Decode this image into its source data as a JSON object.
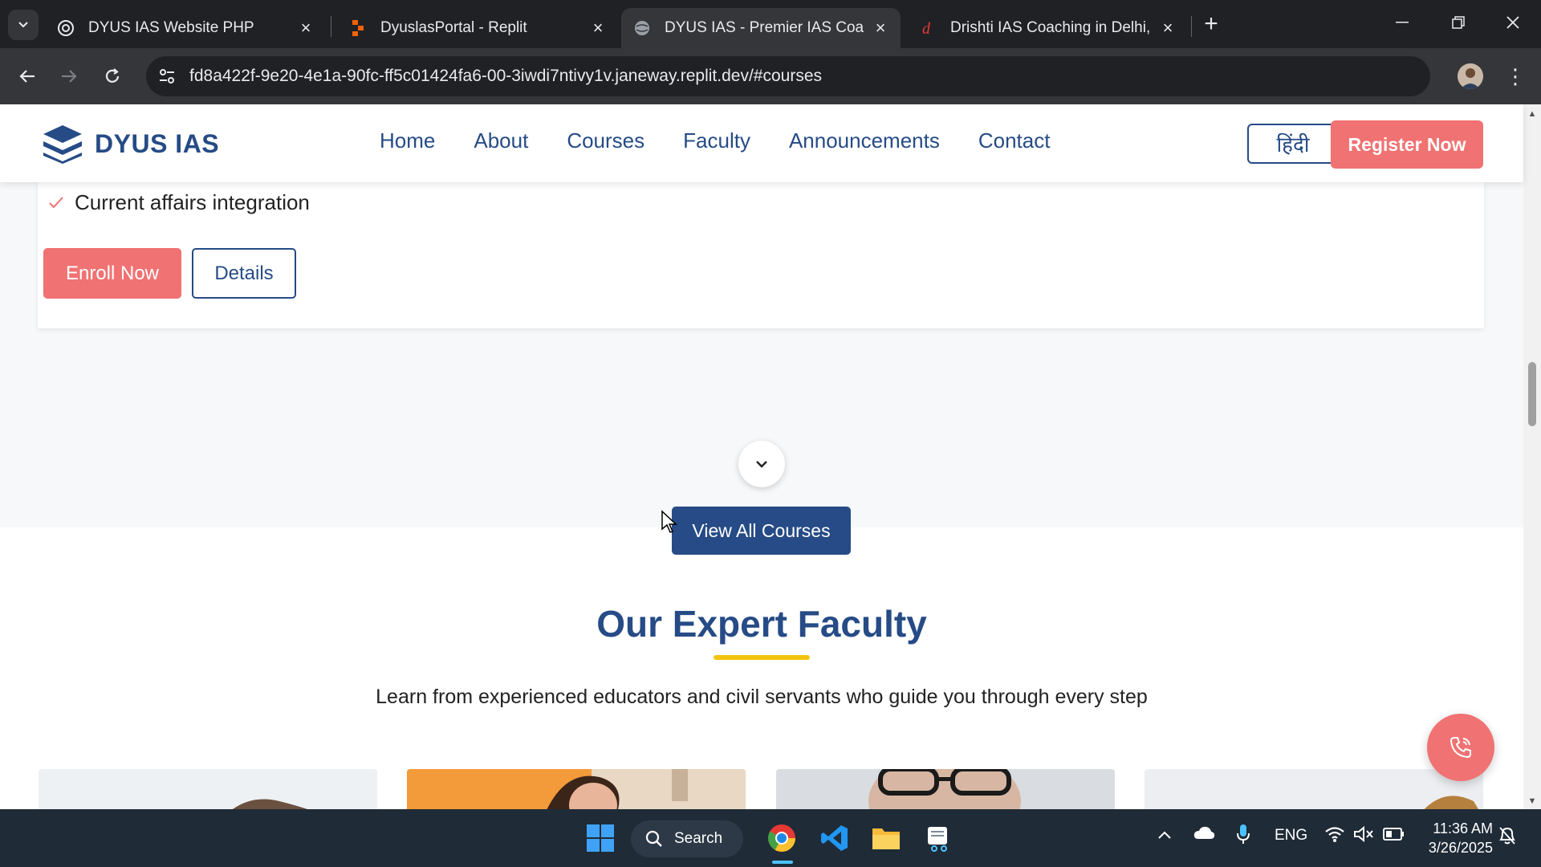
{
  "browser": {
    "tabs": [
      {
        "title": "DYUS IAS Website PHP",
        "active": false
      },
      {
        "title": "DyuslasPortal - Replit",
        "active": false
      },
      {
        "title": "DYUS IAS - Premier IAS Coachir",
        "active": true
      },
      {
        "title": "Drishti IAS Coaching in Delhi, B",
        "active": false
      }
    ],
    "url": "fd8a422f-9e20-4e1a-90fc-ff5c01424fa6-00-3iwdi7ntivy1v.janeway.replit.dev/#courses"
  },
  "site": {
    "brand": "DYUS IAS",
    "nav": [
      "Home",
      "About",
      "Courses",
      "Faculty",
      "Announcements",
      "Contact"
    ],
    "lang_toggle": "हिंदी",
    "register_label": "Register Now"
  },
  "course_card": {
    "feature": "Current affairs integration",
    "enroll_label": "Enroll Now",
    "details_label": "Details"
  },
  "courses": {
    "view_all_label": "View All Courses"
  },
  "faculty": {
    "title_part1": "Our",
    "title_part2": "Expert Faculty",
    "subtitle": "Learn from experienced educators and civil servants who guide you through every step"
  },
  "taskbar": {
    "search_label": "Search",
    "lang": "ENG",
    "time": "11:36 AM",
    "date": "3/26/2025"
  },
  "colors": {
    "brand_blue": "#264b86",
    "accent_coral": "#f07272",
    "underline_yellow": "#f2c40f"
  }
}
